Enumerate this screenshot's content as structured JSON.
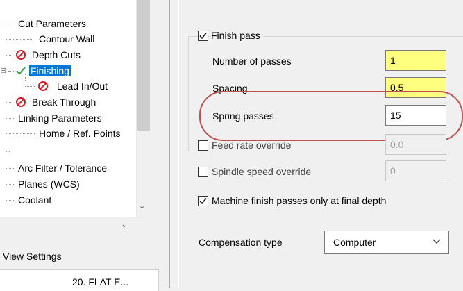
{
  "tree": {
    "items": [
      {
        "label": "Cut Parameters",
        "icon": ""
      },
      {
        "label": "Contour Wall",
        "icon": ""
      },
      {
        "label": "Depth Cuts",
        "icon": "prohibited-icon"
      },
      {
        "label": "Finishing",
        "icon": "checkmark-icon",
        "selected": true
      },
      {
        "label": "Lead In/Out",
        "icon": "prohibited-icon"
      },
      {
        "label": "Break Through",
        "icon": "prohibited-icon"
      },
      {
        "label": "Linking Parameters",
        "icon": ""
      },
      {
        "label": "Home / Ref. Points",
        "icon": ""
      },
      {
        "label": "Arc Filter / Tolerance",
        "icon": ""
      },
      {
        "label": "Planes (WCS)",
        "icon": ""
      },
      {
        "label": "Coolant",
        "icon": ""
      }
    ],
    "view_settings_label": "View Settings",
    "view_box_text": "20. FLAT E..."
  },
  "finish": {
    "finish_pass_label": "Finish pass",
    "finish_pass_checked": true,
    "number_of_passes_label": "Number of passes",
    "number_of_passes_value": "1",
    "spacing_label": "Spacing",
    "spacing_value": "0.5",
    "spring_passes_label": "Spring passes",
    "spring_passes_value": "15",
    "feed_rate_override_label": "Feed rate override",
    "feed_rate_override_checked": false,
    "feed_rate_value": "0.0",
    "spindle_speed_override_label": "Spindle speed override",
    "spindle_speed_override_checked": false,
    "spindle_speed_value": "0",
    "machine_finish_label": "Machine finish passes only at final depth",
    "machine_finish_checked": true,
    "compensation_type_label": "Compensation type",
    "compensation_type_value": "Computer"
  },
  "colors": {
    "selection": "#0078d7",
    "required_field": "#ffff7f",
    "highlight_ellipse": "#c0504d",
    "prohibited": "#e81123",
    "check": "#2e9e3e"
  }
}
